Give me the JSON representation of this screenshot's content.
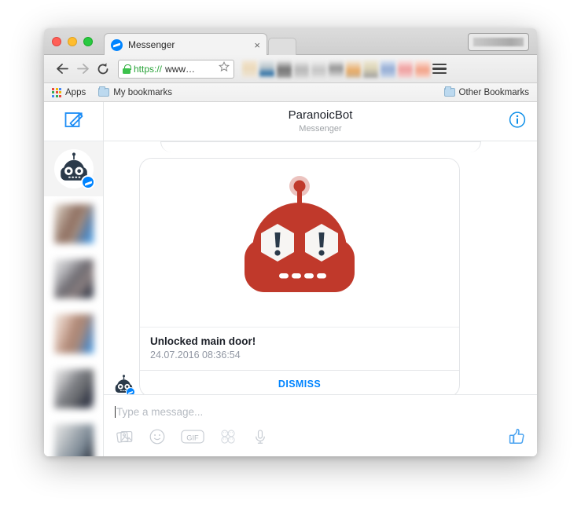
{
  "browser": {
    "tab": {
      "title": "Messenger",
      "favicon": "messenger-icon",
      "close": "×"
    },
    "nav": {
      "back": "←",
      "forward": "→",
      "reload": "⟳"
    },
    "omnibox": {
      "lock": "lock-icon",
      "scheme": "https://",
      "rest": "www…",
      "star": "star-icon"
    },
    "bookmarks": {
      "apps_label": "Apps",
      "folder_label": "My bookmarks",
      "other_label": "Other Bookmarks"
    },
    "menu": "chrome-menu-icon",
    "profile_button": "profile-name-redacted"
  },
  "messenger": {
    "sidebar": {
      "compose_label": "compose-icon",
      "threads": [
        {
          "name": "ParanoicBot",
          "avatar": "robot-avatar",
          "active": true,
          "badge": "messenger-badge"
        },
        {
          "name": "contact-redacted-1",
          "avatar": "blurred-photo",
          "active": false
        },
        {
          "name": "contact-redacted-2",
          "avatar": "blurred-photo",
          "active": false
        },
        {
          "name": "contact-redacted-3",
          "avatar": "blurred-photo",
          "active": false
        },
        {
          "name": "contact-redacted-4",
          "avatar": "blurred-photo",
          "active": false
        },
        {
          "name": "contact-redacted-5",
          "avatar": "blurred-photo",
          "active": false
        }
      ]
    },
    "header": {
      "title": "ParanoicBot",
      "subtitle": "Messenger",
      "info_icon": "info-icon"
    },
    "message_card": {
      "image_alt": "alert-robot-illustration",
      "title": "Unlocked main door!",
      "timestamp": "24.07.2016 08:36:54",
      "action_label": "DISMISS",
      "sender_avatar": "robot-avatar"
    },
    "composer": {
      "placeholder": "Type a message...",
      "tools": [
        {
          "name": "photo-icon",
          "label": "Photo"
        },
        {
          "name": "emoji-icon",
          "label": "Emoji"
        },
        {
          "name": "gif-icon",
          "label": "GIF"
        },
        {
          "name": "sticker-icon",
          "label": "Stickers"
        },
        {
          "name": "microphone-icon",
          "label": "Voice"
        }
      ],
      "like_icon": "thumbs-up-icon"
    }
  },
  "colors": {
    "accent_blue": "#0084ff",
    "robot_red": "#c0392b",
    "robot_navy": "#2b3a4a",
    "muted_text": "#9197a3"
  }
}
